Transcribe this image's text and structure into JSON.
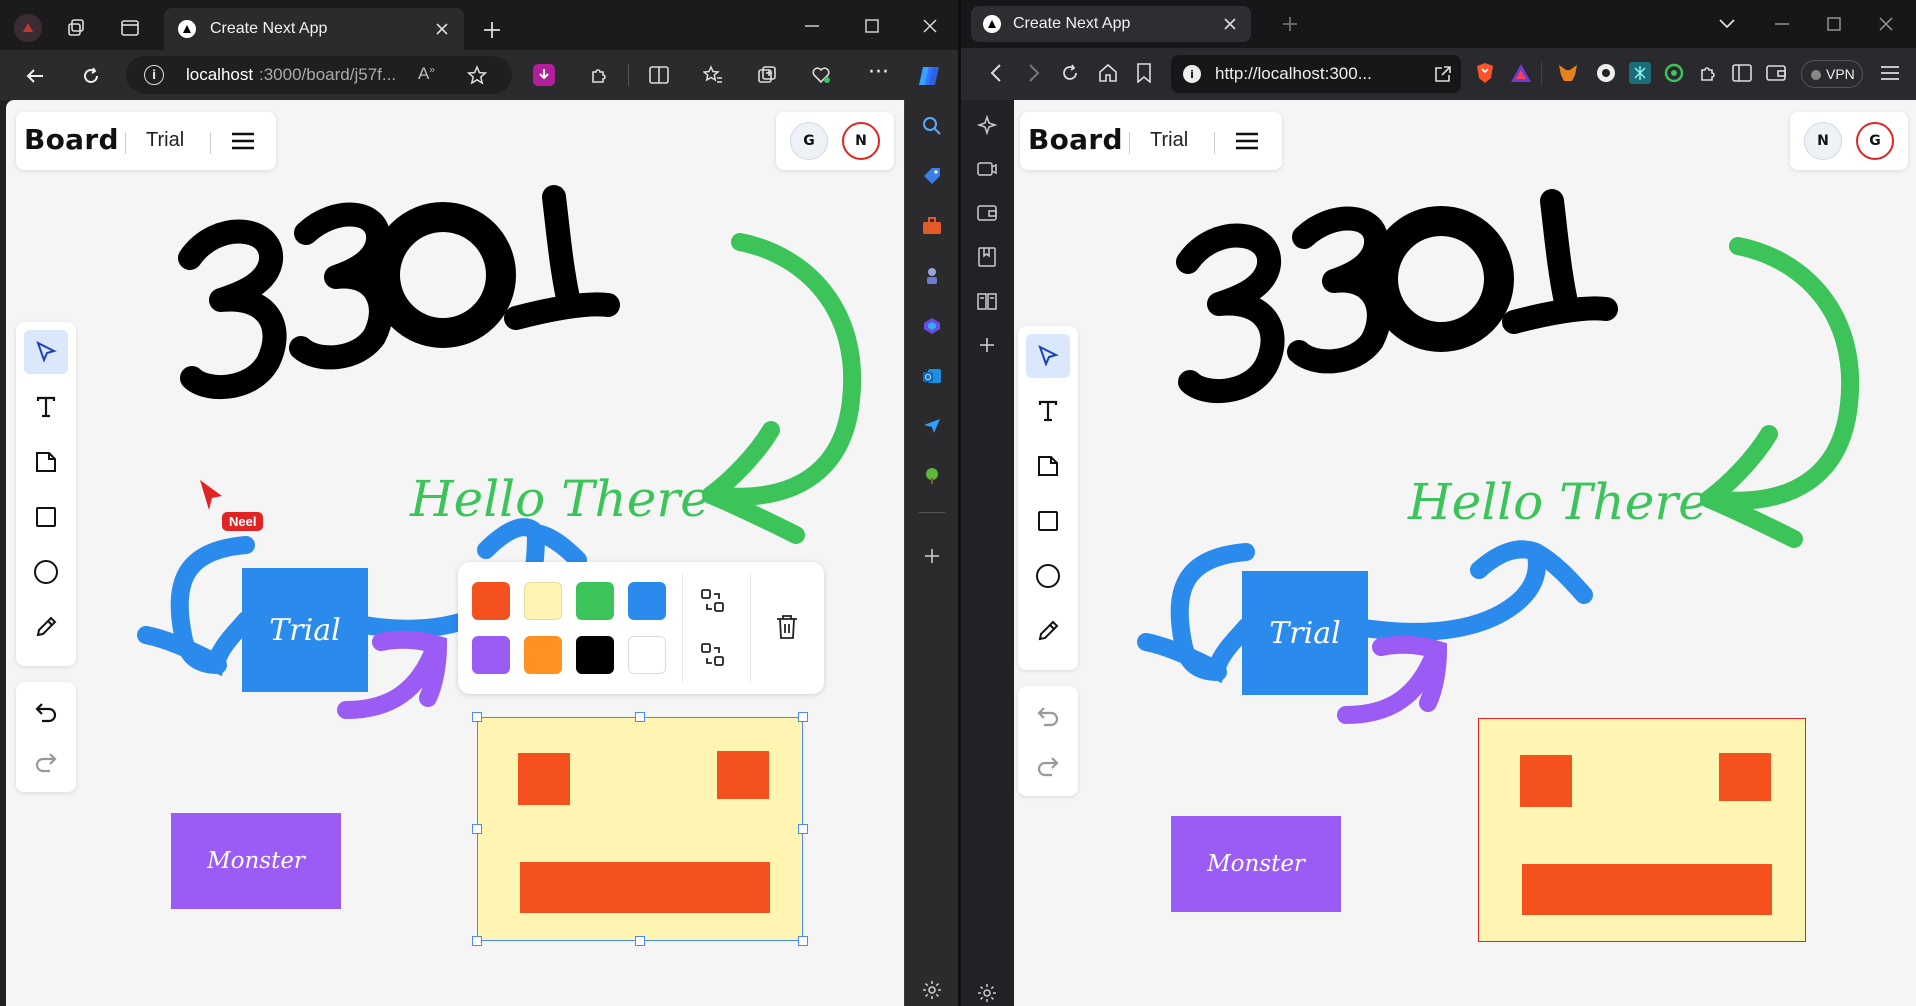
{
  "left_window": {
    "tab_title": "Create Next App",
    "url_host": "localhost",
    "url_rest": ":3000/board/j57f...",
    "app_title": "Board",
    "board_name": "Trial",
    "avatars": [
      "G",
      "N"
    ],
    "cursor_user": "Neel",
    "text_hello": "Hello There",
    "shape_trial": "Trial",
    "shape_monster": "Monster",
    "palette_colors": [
      "#f4511e",
      "#fff5b3",
      "#3cc45a",
      "#2a8bec",
      "#9b5cf6",
      "#ff9120",
      "#000000",
      "#ffffff"
    ]
  },
  "right_window": {
    "tab_title": "Create Next App",
    "url": "http://localhost:300...",
    "vpn_label": "VPN",
    "app_title": "Board",
    "board_name": "Trial",
    "avatars": [
      "N",
      "G"
    ],
    "text_hello": "Hello There",
    "shape_trial": "Trial",
    "shape_monster": "Monster"
  },
  "canvas_number": "3301",
  "colors": {
    "blue": "#2a8bec",
    "purple": "#9b5cf6",
    "green": "#3cc45a",
    "orange": "#f4511e",
    "yellow": "#fff5b3",
    "select": "#4a8af4",
    "cursor_red": "#e02424"
  }
}
